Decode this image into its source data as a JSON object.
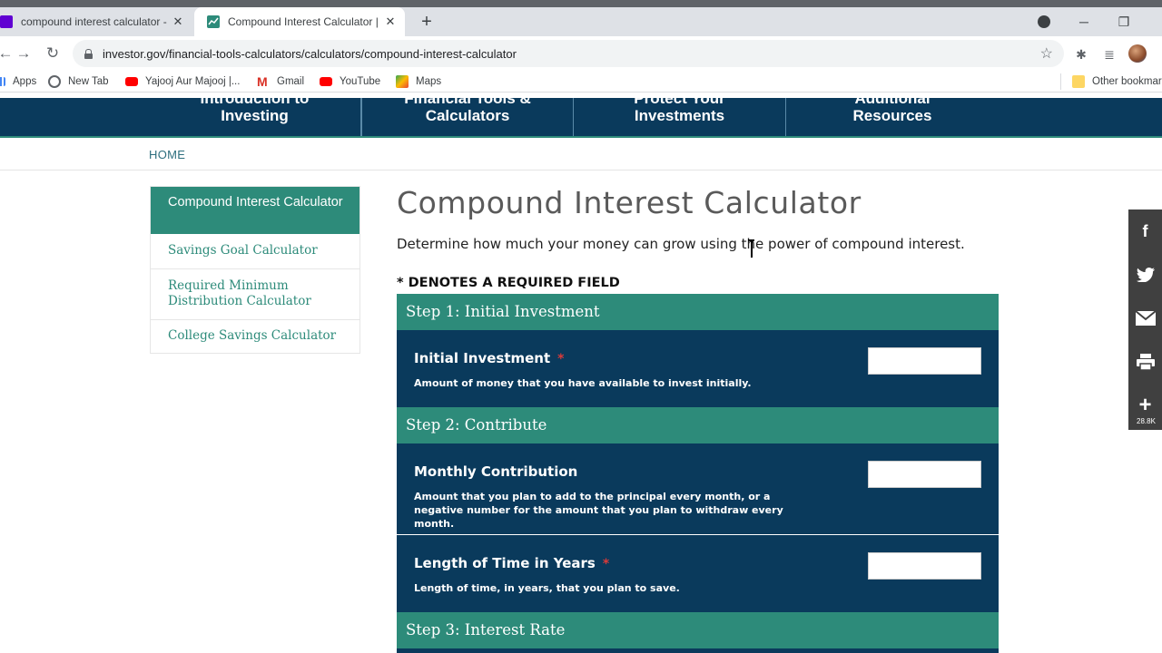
{
  "browser": {
    "tabs": [
      {
        "title": "compound interest calculator - Y"
      },
      {
        "title": "Compound Interest Calculator | I"
      }
    ],
    "url": "investor.gov/financial-tools-calculators/calculators/compound-interest-calculator",
    "bookmarks": [
      {
        "label": "Apps",
        "color": "#4285f4"
      },
      {
        "label": "New Tab",
        "color": "#5f6368"
      },
      {
        "label": "Yajooj Aur Majooj |...",
        "color": "#ff0000"
      },
      {
        "label": "Gmail",
        "color": "#d93025"
      },
      {
        "label": "YouTube",
        "color": "#ff0000"
      },
      {
        "label": "Maps",
        "color": "#34a853"
      }
    ],
    "other_bookmarks": "Other bookmarks"
  },
  "site_nav": [
    {
      "line1": "Introduction to",
      "line2": "Investing"
    },
    {
      "line1": "Financial Tools &",
      "line2": "Calculators"
    },
    {
      "line1": "Protect Your",
      "line2": "Investments"
    },
    {
      "line1": "Additional",
      "line2": "Resources"
    }
  ],
  "breadcrumb": "HOME",
  "sidebar": [
    {
      "label": "Compound Interest Calculator",
      "active": true
    },
    {
      "label": "Savings Goal Calculator"
    },
    {
      "label": "Required Minimum Distribution Calculator"
    },
    {
      "label": "College Savings Calculator"
    }
  ],
  "main": {
    "title": "Compound Interest Calculator",
    "intro": "Determine how much your money can grow using the power of compound interest.",
    "required_note": "* DENOTES A REQUIRED FIELD",
    "steps": [
      {
        "label": "Step 1: Initial Investment"
      },
      {
        "label": "Step 2: Contribute"
      },
      {
        "label": "Step 3: Interest Rate"
      }
    ],
    "fields": [
      {
        "label": "Initial Investment",
        "required": "*",
        "desc": "Amount of money that you have available to invest initially.",
        "value": ""
      },
      {
        "label": "Monthly Contribution",
        "required": "",
        "desc": "Amount that you plan to add to the principal every month, or a negative number for the amount that you plan to withdraw every month.",
        "value": ""
      },
      {
        "label": "Length of Time in Years",
        "required": "*",
        "desc": "Length of time, in years, that you plan to save.",
        "value": ""
      }
    ]
  },
  "social": {
    "count": "28.8K"
  },
  "colors": {
    "navy": "#0a3a5c",
    "teal": "#2d8b7a"
  }
}
